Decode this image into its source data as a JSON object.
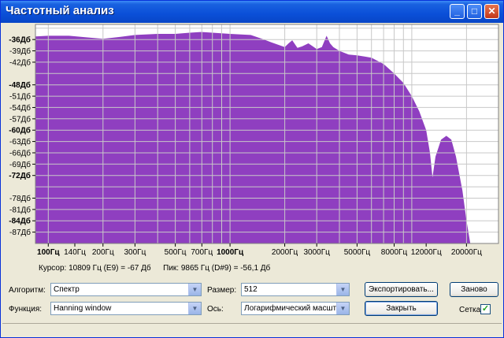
{
  "window": {
    "title": "Частотный анализ",
    "minimize_glyph": "_",
    "maximize_glyph": "□",
    "close_glyph": "✕"
  },
  "colors": {
    "fill": "#8f3fc0",
    "grid": "#c8c8c8",
    "plot_bg": "#ffffff",
    "accent": "#0a4fd8"
  },
  "chart_data": {
    "type": "area",
    "x_scale": "log",
    "xlim": [
      85,
      30000
    ],
    "ylim": [
      -90,
      -32
    ],
    "y_ticks": [
      {
        "value": -36,
        "label": "-36Дб",
        "bold": true
      },
      {
        "value": -39,
        "label": "-39Дб",
        "bold": false
      },
      {
        "value": -42,
        "label": "-42Дб",
        "bold": false
      },
      {
        "value": -48,
        "label": "-48Дб",
        "bold": true
      },
      {
        "value": -51,
        "label": "-51Дб",
        "bold": false
      },
      {
        "value": -54,
        "label": "-54Дб",
        "bold": false
      },
      {
        "value": -57,
        "label": "-57Дб",
        "bold": false
      },
      {
        "value": -60,
        "label": "-60Дб",
        "bold": true
      },
      {
        "value": -63,
        "label": "-63Дб",
        "bold": false
      },
      {
        "value": -66,
        "label": "-66Дб",
        "bold": false
      },
      {
        "value": -69,
        "label": "-69Дб",
        "bold": false
      },
      {
        "value": -72,
        "label": "-72Дб",
        "bold": true
      },
      {
        "value": -78,
        "label": "-78Дб",
        "bold": false
      },
      {
        "value": -81,
        "label": "-81Дб",
        "bold": false
      },
      {
        "value": -84,
        "label": "-84Дб",
        "bold": true
      },
      {
        "value": -87,
        "label": "-87Дб",
        "bold": false
      }
    ],
    "x_ticks": [
      {
        "value": 100,
        "label": "100Гц",
        "bold": true
      },
      {
        "value": 140,
        "label": "140Гц",
        "bold": false
      },
      {
        "value": 200,
        "label": "200Гц",
        "bold": false
      },
      {
        "value": 300,
        "label": "300Гц",
        "bold": false
      },
      {
        "value": 500,
        "label": "500Гц",
        "bold": false
      },
      {
        "value": 700,
        "label": "700Гц",
        "bold": false
      },
      {
        "value": 1000,
        "label": "1000Гц",
        "bold": true
      },
      {
        "value": 2000,
        "label": "2000Гц",
        "bold": false
      },
      {
        "value": 3000,
        "label": "3000Гц",
        "bold": false
      },
      {
        "value": 5000,
        "label": "5000Гц",
        "bold": false
      },
      {
        "value": 8000,
        "label": "8000Гц",
        "bold": false
      },
      {
        "value": 12000,
        "label": "12000Гц",
        "bold": false
      },
      {
        "value": 20000,
        "label": "20000Гц",
        "bold": false
      }
    ],
    "grid_x": [
      100,
      200,
      300,
      400,
      500,
      600,
      700,
      800,
      900,
      1000,
      2000,
      3000,
      4000,
      5000,
      6000,
      7000,
      8000,
      9000,
      10000,
      20000
    ],
    "grid_y": [
      -33,
      -36,
      -39,
      -42,
      -45,
      -48,
      -51,
      -54,
      -57,
      -60,
      -63,
      -66,
      -69,
      -72,
      -75,
      -78,
      -81,
      -84,
      -87,
      -90
    ],
    "grid": true,
    "series": [
      {
        "points": [
          [
            85,
            -35.2
          ],
          [
            100,
            -35.0
          ],
          [
            130,
            -35.0
          ],
          [
            160,
            -35.4
          ],
          [
            200,
            -35.8
          ],
          [
            250,
            -35.3
          ],
          [
            300,
            -34.8
          ],
          [
            400,
            -34.5
          ],
          [
            500,
            -34.5
          ],
          [
            600,
            -34.2
          ],
          [
            700,
            -34.0
          ],
          [
            800,
            -34.2
          ],
          [
            1000,
            -34.5
          ],
          [
            1300,
            -34.8
          ],
          [
            1500,
            -35.8
          ],
          [
            1700,
            -36.8
          ],
          [
            2000,
            -38.0
          ],
          [
            2100,
            -37.0
          ],
          [
            2200,
            -36.2
          ],
          [
            2350,
            -38.2
          ],
          [
            2500,
            -37.8
          ],
          [
            2700,
            -37.0
          ],
          [
            3000,
            -38.5
          ],
          [
            3200,
            -38.0
          ],
          [
            3400,
            -35.0
          ],
          [
            3550,
            -37.0
          ],
          [
            3700,
            -38.0
          ],
          [
            4000,
            -39.0
          ],
          [
            4500,
            -40.0
          ],
          [
            5000,
            -40.2
          ],
          [
            5500,
            -40.5
          ],
          [
            6000,
            -40.8
          ],
          [
            7000,
            -42.5
          ],
          [
            8000,
            -45.0
          ],
          [
            9000,
            -47.5
          ],
          [
            10000,
            -51.0
          ],
          [
            11000,
            -55.0
          ],
          [
            12000,
            -60.0
          ],
          [
            12600,
            -66.0
          ],
          [
            13000,
            -72.5
          ],
          [
            13500,
            -67.0
          ],
          [
            14500,
            -62.5
          ],
          [
            15500,
            -61.5
          ],
          [
            16500,
            -62.5
          ],
          [
            17500,
            -67.0
          ],
          [
            19000,
            -76.0
          ],
          [
            20000,
            -84.0
          ],
          [
            21000,
            -90.0
          ]
        ]
      }
    ]
  },
  "status": {
    "cursor": "Курсор: 10809 Гц (E9) = -67 Дб",
    "peak": "Пик: 9865 Гц (D#9) = -56,1 Дб"
  },
  "controls": {
    "algorithm_label": "Алгоритм:",
    "algorithm_value": "Спектр",
    "function_label": "Функция:",
    "function_value": "Hanning window",
    "size_label": "Размер:",
    "size_value": "512",
    "axis_label": "Ось:",
    "axis_value": "Логарифмический масштаб",
    "export_label": "Экспортировать...",
    "close_label": "Закрыть",
    "replot_label": "Заново",
    "grid_label": "Сетка",
    "grid_checked": true,
    "dropdown_glyph": "▼"
  }
}
